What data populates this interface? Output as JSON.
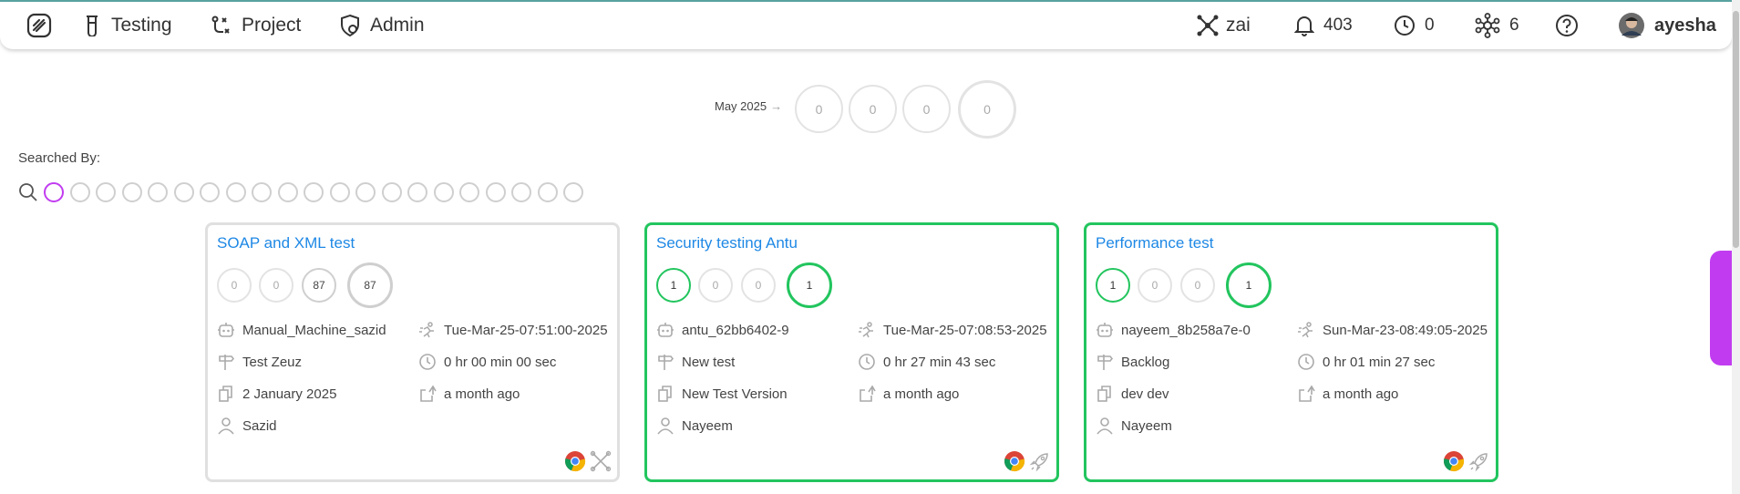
{
  "nav": {
    "testing": "Testing",
    "project": "Project",
    "admin": "Admin",
    "ai_label": "zai",
    "notifications": "403",
    "pending": "0",
    "connections": "6",
    "user": "ayesha"
  },
  "summary": {
    "month": "May 2025",
    "counts": [
      "0",
      "0",
      "0",
      "0"
    ]
  },
  "search": {
    "label": "Searched By:",
    "filter_count": 21
  },
  "cards": [
    {
      "title": "SOAP and XML test",
      "counts": [
        "0",
        "0",
        "87",
        "87"
      ],
      "machine": "Manual_Machine_sazid",
      "started": "Tue-Mar-25-07:51:00-2025",
      "milestone": "Test Zeuz",
      "duration": "0 hr 00 min 00 sec",
      "version": "2 January 2025",
      "updated": "a month ago",
      "user": "Sazid"
    },
    {
      "title": "Security testing Antu",
      "counts": [
        "1",
        "0",
        "0",
        "1"
      ],
      "machine": "antu_62bb6402-9",
      "started": "Tue-Mar-25-07:08:53-2025",
      "milestone": "New test",
      "duration": "0 hr 27 min 43 sec",
      "version": "New Test Version",
      "updated": "a month ago",
      "user": "Nayeem"
    },
    {
      "title": "Performance test",
      "counts": [
        "1",
        "0",
        "0",
        "1"
      ],
      "machine": "nayeem_8b258a7e-0",
      "started": "Sun-Mar-23-08:49:05-2025",
      "milestone": "Backlog",
      "duration": "0 hr 01 min 27 sec",
      "version": "dev dev",
      "updated": "a month ago",
      "user": "Nayeem"
    }
  ],
  "colors": {
    "accent": "#c13cf0",
    "link": "#1e88e5",
    "success": "#22c55e"
  },
  "icons": [
    "logo-icon",
    "beaker-icon",
    "project-flow-icon",
    "shield-icon",
    "ai-node-icon",
    "bell-icon",
    "clock-icon",
    "network-icon",
    "help-icon",
    "avatar",
    "search-icon",
    "robot-icon",
    "run-icon",
    "signpost-icon",
    "copy-icon",
    "person-icon",
    "upload-icon",
    "chrome-icon",
    "rocket-icon",
    "cross-arrows-icon"
  ]
}
